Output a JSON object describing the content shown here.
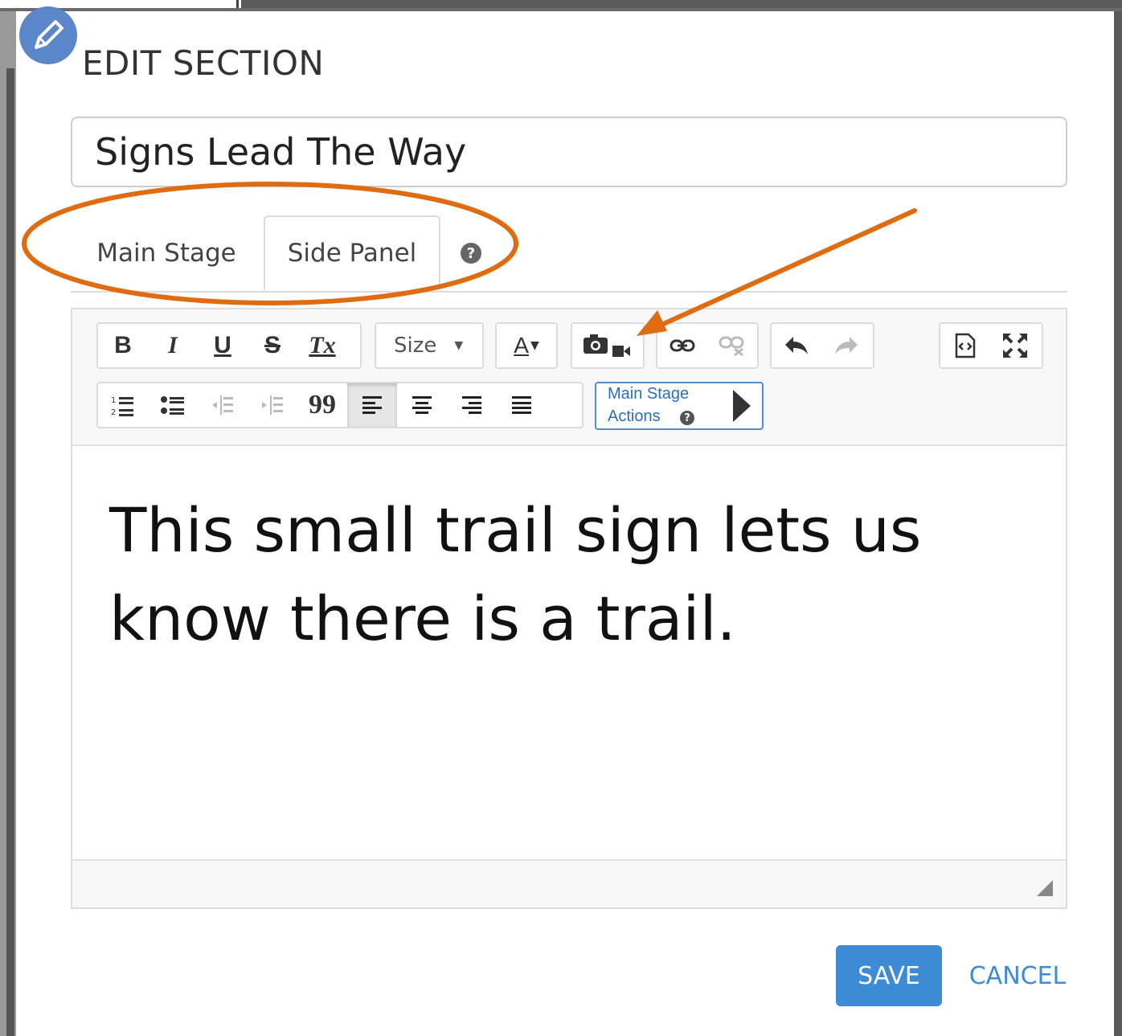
{
  "dialog": {
    "title": "EDIT SECTION"
  },
  "section": {
    "title_value": "Signs Lead The Way"
  },
  "tabs": [
    {
      "label": "Main Stage",
      "active": false
    },
    {
      "label": "Side Panel",
      "active": true
    }
  ],
  "toolbar": {
    "bold": "B",
    "italic": "I",
    "underline": "U",
    "strike": "S",
    "clear_format": "Tx",
    "size_label": "Size",
    "font_color": "A",
    "blockquote": "99",
    "main_stage_actions_line1": "Main Stage",
    "main_stage_actions_line2": "Actions"
  },
  "editor": {
    "content": "This small trail sign lets us know there is a trail."
  },
  "actions": {
    "save_label": "SAVE",
    "cancel_label": "CANCEL"
  },
  "colors": {
    "primary": "#3d8bd4",
    "annotation": "#e06c12",
    "badge": "#5b86c9"
  }
}
